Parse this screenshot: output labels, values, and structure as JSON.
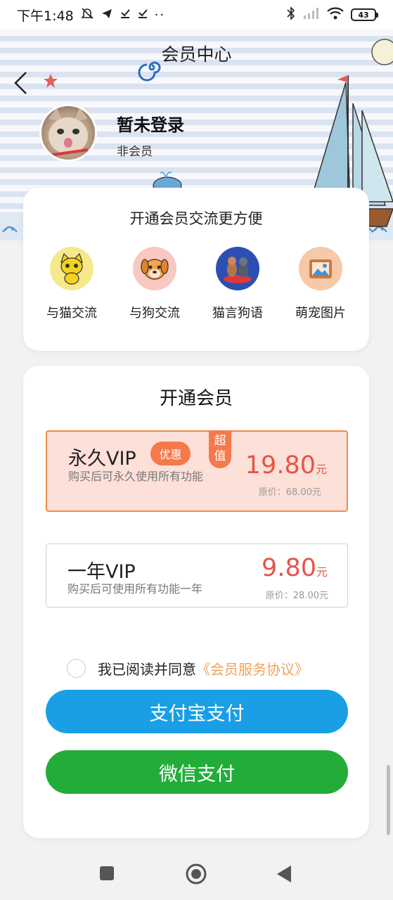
{
  "status_bar": {
    "time": "下午1:48",
    "battery": "43"
  },
  "header": {
    "title": "会员中心",
    "user_name": "暂未登录",
    "user_status": "非会员"
  },
  "features": {
    "title": "开通会员交流更方便",
    "items": [
      {
        "label": "与猫交流",
        "icon": "cat-icon",
        "color": "#f5e98a"
      },
      {
        "label": "与狗交流",
        "icon": "dog-icon",
        "color": "#f9c8c0"
      },
      {
        "label": "猫言狗语",
        "icon": "pets-icon",
        "color": "#2d4fb3"
      },
      {
        "label": "萌宠图片",
        "icon": "picture-icon",
        "color": "#f6c9a8"
      }
    ]
  },
  "membership": {
    "title": "开通会员",
    "plans": [
      {
        "name": "永久VIP",
        "badge": "优惠",
        "tag": "超值",
        "desc": "购买后可永久使用所有功能",
        "price": "19.80",
        "unit": "元",
        "original": "原价：68.00元",
        "selected": true
      },
      {
        "name": "一年VIP",
        "desc": "购买后可使用所有功能一年",
        "price": "9.80",
        "unit": "元",
        "original": "原价：28.00元",
        "selected": false
      }
    ],
    "agree_text": "我已阅读并同意",
    "agree_link": "《会员服务协议》",
    "alipay_label": "支付宝支付",
    "wechat_label": "微信支付"
  },
  "colors": {
    "accent_orange": "#f5794a",
    "price_red": "#e6544b",
    "alipay_blue": "#1a9fe6",
    "wechat_green": "#22ad39"
  }
}
